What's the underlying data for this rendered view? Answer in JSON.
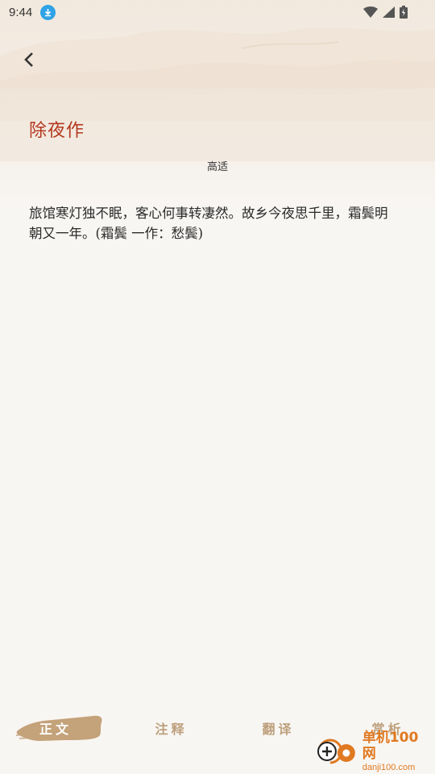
{
  "status_bar": {
    "time": "9:44"
  },
  "poem": {
    "title": "除夜作",
    "author": "高适",
    "body": "旅馆寒灯独不眠，客心何事转凄然。故乡今夜思千里，霜鬓明朝又一年。(霜鬓 一作：愁鬓)"
  },
  "tabs": [
    {
      "label": "正文",
      "active": true
    },
    {
      "label": "注释",
      "active": false
    },
    {
      "label": "翻译",
      "active": false
    },
    {
      "label": "赏析",
      "active": false
    }
  ],
  "watermark": {
    "cn": "单机100网",
    "en": "danji100.com"
  },
  "colors": {
    "title": "#b3381f",
    "tab_inactive": "#bda07c",
    "brush": "#c4a27a",
    "background": "#f8f6f3"
  }
}
